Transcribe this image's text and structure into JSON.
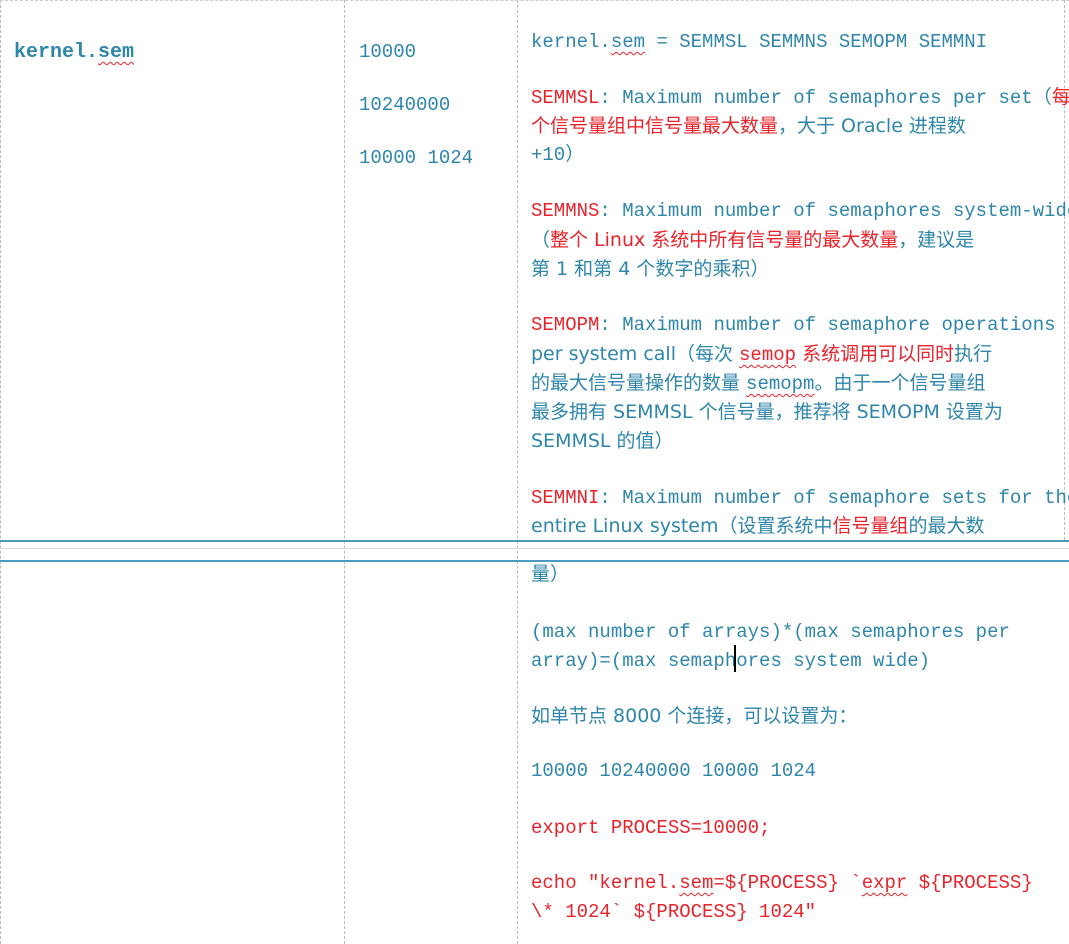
{
  "row1": {
    "param_name_prefix": "kernel.",
    "param_name_suffix": "sem",
    "values": [
      "10000",
      "10240000",
      "10000 1024"
    ],
    "desc": {
      "formula_prefix": "kernel.",
      "formula_sem": "sem",
      "formula_rest": " = SEMMSL SEMMNS SEMOPM SEMMNI",
      "semmsl_key": "SEMMSL",
      "semmsl_en": ": Maximum number of semaphores per set（",
      "semmsl_cn1": "每",
      "semmsl_cn2": "个信号量组中信号量最大数量",
      "semmsl_cn3": "，大于 Oracle 进程数",
      "semmsl_end": "+10）",
      "semmns_key": "SEMMNS",
      "semmns_en": ": Maximum number of semaphores system-wide",
      "semmns_cn1": "（",
      "semmns_cn2": "整个 Linux 系统中所有信号量的最大数量",
      "semmns_cn3": "，建议是",
      "semmns_cn4": "第 1 和第 4 个数字的乘积）",
      "semopm_key": "SEMOPM",
      "semopm_en": ": Maximum number of semaphore operations",
      "semopm_l2a": "per system call（每次 ",
      "semopm_l2b": "semop",
      "semopm_l2c": " 系统调用可以同时",
      "semopm_l2d": "执行",
      "semopm_l3a": "的最大信号量操作的数量 ",
      "semopm_l3b": "semopm",
      "semopm_l3c": "。由于一个信号量组",
      "semopm_l4": "最多拥有 SEMMSL 个信号量，推荐将 SEMOPM 设置为",
      "semopm_l5": "SEMMSL 的值）",
      "semmni_key": "SEMMNI",
      "semmni_en": ": Maximum number of semaphore sets for the",
      "semmni_l2a": "entire Linux system（设置系统中",
      "semmni_l2b": "信号量组",
      "semmni_l2c": "的最大数"
    }
  },
  "row2": {
    "semmni_l3": "量）",
    "calc_l1": "  (max number of arrays)*(max semaphores per",
    "calc_l2": "array)=(max semaphores system wide)",
    "example_intro": "如单节点 8000 个连接，可以设置为：",
    "example_values": "10000  10240000 10000 1024",
    "export_cmd": "export PROCESS=10000;",
    "echo_l1a": "echo \"kernel.",
    "echo_l1b": "sem",
    "echo_l1c": "=${PROCESS}   `",
    "echo_l1d": "expr",
    "echo_l1e": " ${PROCESS}",
    "echo_l2": "\\* 1024` ${PROCESS} 1024\""
  },
  "colors": {
    "text_blue": "#2e86ab",
    "text_red": "#e8232b",
    "rule_blue": "#2e86ab"
  }
}
